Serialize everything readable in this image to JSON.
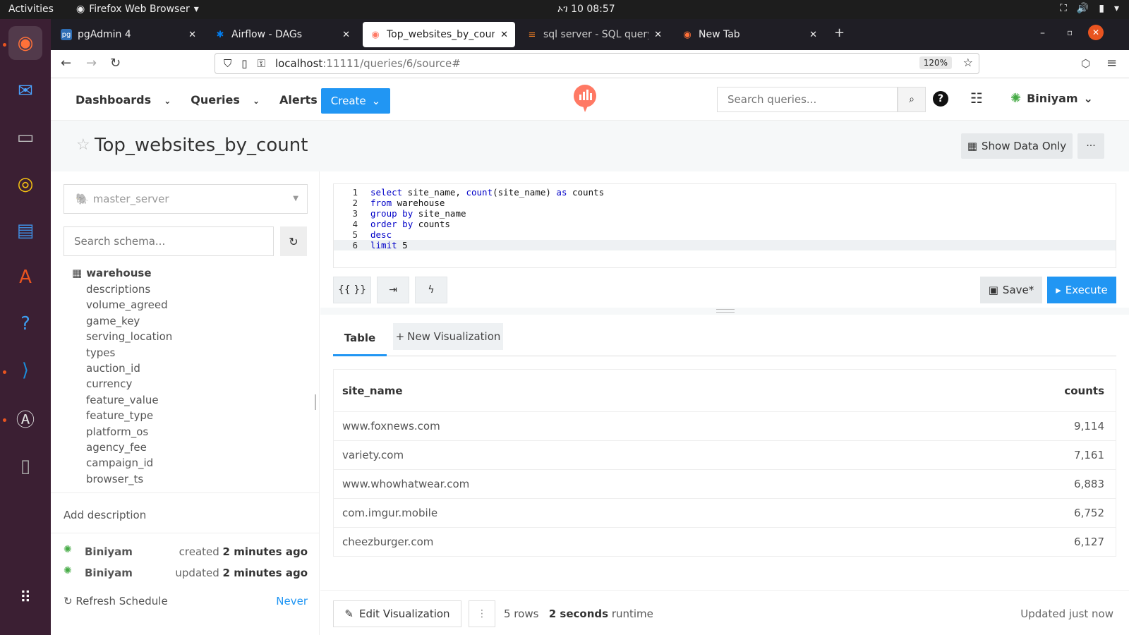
{
  "os": {
    "activities": "Activities",
    "app_menu": "Firefox Web Browser",
    "clock": "ኦገ 10  08:57"
  },
  "browser": {
    "tabs": [
      {
        "title": "pgAdmin 4",
        "fav": "pg",
        "fav_color": "#2f6eb5",
        "active": false
      },
      {
        "title": "Airflow - DAGs",
        "fav": "✱",
        "fav_color": "#017cee",
        "active": false
      },
      {
        "title": "Top_websites_by_count",
        "fav": "◉",
        "fav_color": "#ff7964",
        "active": true
      },
      {
        "title": "sql server - SQL query to",
        "fav": "≡",
        "fav_color": "#f48024",
        "active": false
      },
      {
        "title": "New Tab",
        "fav": "◉",
        "fav_color": "#ff7139",
        "active": false
      }
    ],
    "url_host": "localhost",
    "url_rest": ":11111/queries/6/source#",
    "zoom": "120%"
  },
  "header": {
    "nav": [
      "Dashboards",
      "Queries",
      "Alerts"
    ],
    "create_label": "Create",
    "search_placeholder": "Search queries...",
    "user": "Biniyam"
  },
  "query": {
    "title": "Top_websites_by_count",
    "show_data_only": "Show Data Only",
    "data_source": "master_server",
    "schema_placeholder": "Search schema...",
    "schema": {
      "table": "warehouse",
      "columns": [
        "descriptions",
        "volume_agreed",
        "game_key",
        "serving_location",
        "types",
        "auction_id",
        "currency",
        "feature_value",
        "feature_type",
        "platform_os",
        "agency_fee",
        "campaign_id",
        "browser_ts"
      ]
    },
    "add_description": "Add description",
    "created": {
      "user": "Biniyam",
      "verb": "created",
      "time": "2 minutes ago"
    },
    "updated": {
      "user": "Biniyam",
      "verb": "updated",
      "time": "2 minutes ago"
    },
    "refresh_label": "Refresh Schedule",
    "refresh_value": "Never",
    "sql_lines": [
      "select site_name, count(site_name) as counts",
      "from warehouse",
      "group by site_name",
      "order by counts",
      "desc",
      "limit 5"
    ],
    "save_label": "Save*",
    "execute_label": "Execute"
  },
  "results": {
    "tab_table": "Table",
    "tab_new_vis": "New Visualization",
    "columns": [
      "site_name",
      "counts"
    ],
    "rows": [
      [
        "www.foxnews.com",
        "9,114"
      ],
      [
        "variety.com",
        "7,161"
      ],
      [
        "www.whowhatwear.com",
        "6,883"
      ],
      [
        "com.imgur.mobile",
        "6,752"
      ],
      [
        "cheezburger.com",
        "6,127"
      ]
    ],
    "edit_vis": "Edit Visualization",
    "rows_count": "5 rows",
    "runtime": "2 seconds",
    "runtime_suffix": "runtime",
    "updated": "Updated just now"
  }
}
